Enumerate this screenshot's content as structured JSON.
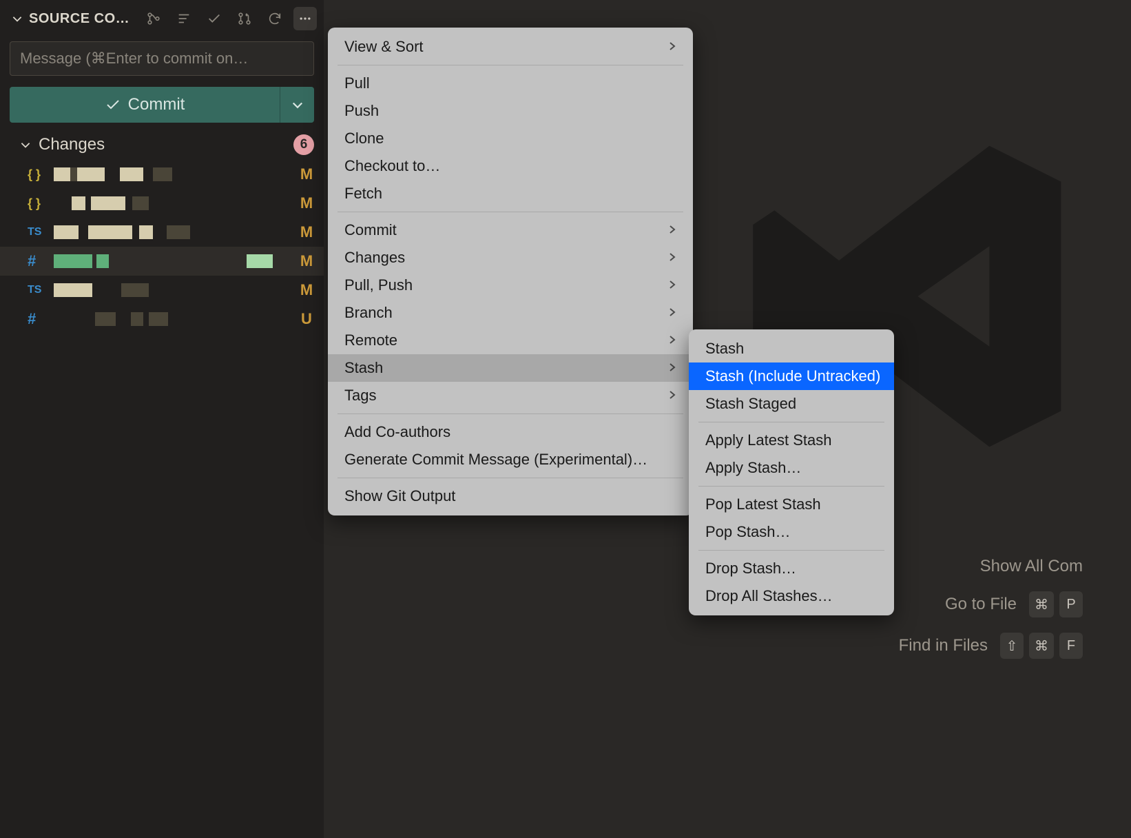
{
  "panel": {
    "title": "SOURCE CO…",
    "commit_message_placeholder": "Message (⌘Enter to commit on…",
    "commit_button": "Commit"
  },
  "changes": {
    "section_title": "Changes",
    "count": "6",
    "files": [
      {
        "icon": "json",
        "status": "M"
      },
      {
        "icon": "json",
        "status": "M"
      },
      {
        "icon": "ts",
        "status": "M"
      },
      {
        "icon": "hash",
        "status": "M"
      },
      {
        "icon": "ts",
        "status": "M"
      },
      {
        "icon": "hash",
        "status": "U"
      }
    ]
  },
  "menu": {
    "items": [
      {
        "label": "View & Sort",
        "submenu": true
      },
      {
        "sep": true
      },
      {
        "label": "Pull"
      },
      {
        "label": "Push"
      },
      {
        "label": "Clone"
      },
      {
        "label": "Checkout to…"
      },
      {
        "label": "Fetch"
      },
      {
        "sep": true
      },
      {
        "label": "Commit",
        "submenu": true
      },
      {
        "label": "Changes",
        "submenu": true
      },
      {
        "label": "Pull, Push",
        "submenu": true
      },
      {
        "label": "Branch",
        "submenu": true
      },
      {
        "label": "Remote",
        "submenu": true
      },
      {
        "label": "Stash",
        "submenu": true,
        "hovered": true
      },
      {
        "label": "Tags",
        "submenu": true
      },
      {
        "sep": true
      },
      {
        "label": "Add Co-authors"
      },
      {
        "label": "Generate Commit Message (Experimental)…"
      },
      {
        "sep": true
      },
      {
        "label": "Show Git Output"
      }
    ]
  },
  "submenu": {
    "items": [
      {
        "label": "Stash"
      },
      {
        "label": "Stash (Include Untracked)",
        "selected": true
      },
      {
        "label": "Stash Staged"
      },
      {
        "sep": true
      },
      {
        "label": "Apply Latest Stash"
      },
      {
        "label": "Apply Stash…"
      },
      {
        "sep": true
      },
      {
        "label": "Pop Latest Stash"
      },
      {
        "label": "Pop Stash…"
      },
      {
        "sep": true
      },
      {
        "label": "Drop Stash…"
      },
      {
        "label": "Drop All Stashes…"
      }
    ]
  },
  "welcome": {
    "shortcuts": [
      {
        "label": "Show All Com",
        "keys": []
      },
      {
        "label": "Go to File",
        "keys": [
          "⌘",
          "P"
        ]
      },
      {
        "label": "Find in Files",
        "keys": [
          "⇧",
          "⌘",
          "F"
        ]
      }
    ]
  }
}
